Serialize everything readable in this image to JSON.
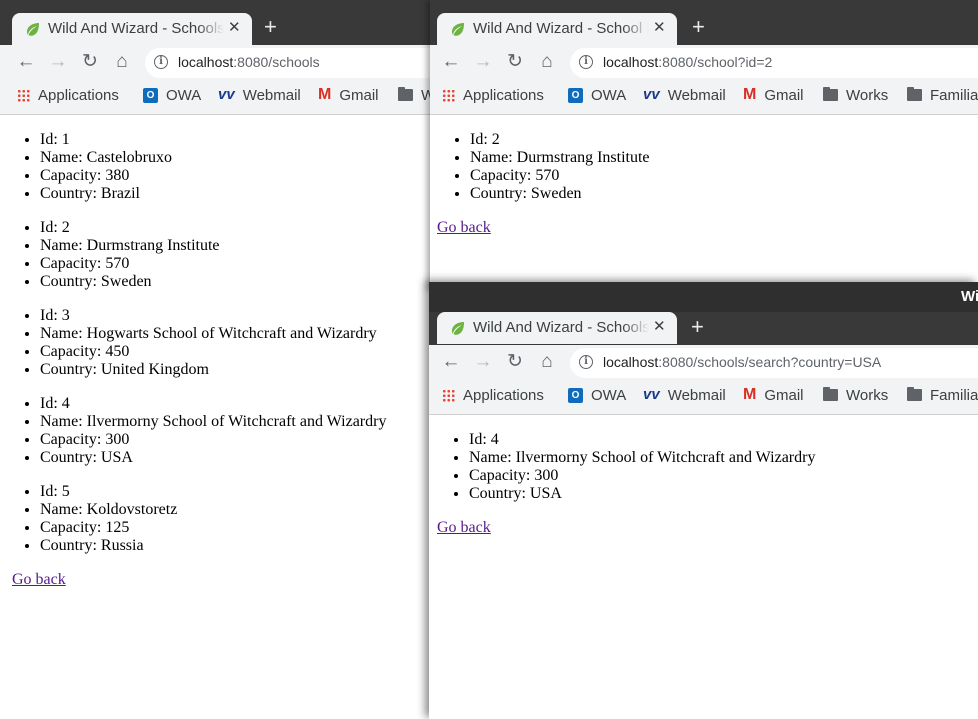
{
  "windows": [
    {
      "tab_title": "Wild And Wizard - Schools",
      "url_host": "localhost",
      "url_rest": ":8080/schools",
      "schools": [
        {
          "id": "Id: 1",
          "name": "Name: Castelobruxo",
          "capacity": "Capacity: 380",
          "country": "Country: Brazil"
        },
        {
          "id": "Id: 2",
          "name": "Name: Durmstrang Institute",
          "capacity": "Capacity: 570",
          "country": "Country: Sweden"
        },
        {
          "id": "Id: 3",
          "name": "Name: Hogwarts School of Witchcraft and Wizardry",
          "capacity": "Capacity: 450",
          "country": "Country: United Kingdom"
        },
        {
          "id": "Id: 4",
          "name": "Name: Ilvermorny School of Witchcraft and Wizardry",
          "capacity": "Capacity: 300",
          "country": "Country: USA"
        },
        {
          "id": "Id: 5",
          "name": "Name: Koldovstoretz",
          "capacity": "Capacity: 125",
          "country": "Country: Russia"
        }
      ],
      "go_back": "Go back"
    },
    {
      "tab_title": "Wild And Wizard - School I",
      "url_host": "localhost",
      "url_rest": ":8080/school?id=2",
      "schools": [
        {
          "id": "Id: 2",
          "name": "Name: Durmstrang Institute",
          "capacity": "Capacity: 570",
          "country": "Country: Sweden"
        }
      ],
      "go_back": "Go back"
    },
    {
      "os_title": "Wi",
      "tab_title": "Wild And Wizard - Schools",
      "url_host": "localhost",
      "url_rest": ":8080/schools/search?country=USA",
      "schools": [
        {
          "id": "Id: 4",
          "name": "Name: Ilvermorny School of Witchcraft and Wizardry",
          "capacity": "Capacity: 300",
          "country": "Country: USA"
        }
      ],
      "go_back": "Go back"
    }
  ],
  "bookmarks": [
    "Applications",
    "OWA",
    "Webmail",
    "Gmail",
    "Works",
    "Familia"
  ],
  "bookmarks_w1": [
    "Applications",
    "OWA",
    "Webmail",
    "Gmail",
    "W"
  ],
  "icons": {
    "close": "✕",
    "plus": "+",
    "back": "←",
    "forward": "→",
    "reload": "↻",
    "home": "⌂",
    "info": "i"
  }
}
